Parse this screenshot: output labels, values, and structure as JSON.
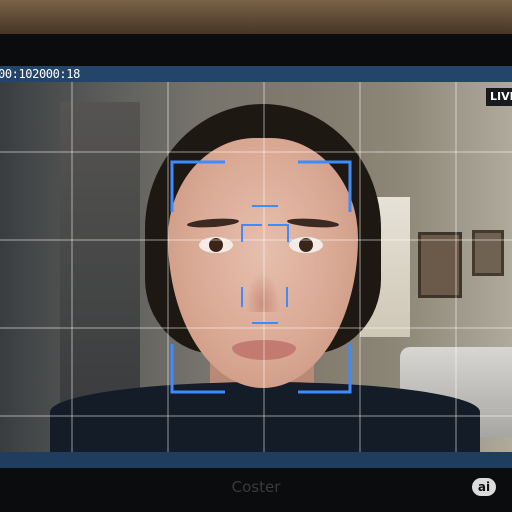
{
  "monitor": {
    "timecode": "00:102000:18",
    "live_label": "LIVE",
    "brand": "Coster",
    "badge": "ai"
  },
  "overlay": {
    "grid": "on",
    "grid_color": "#ffffff",
    "bracket_color": "#3d8bff",
    "top_bar_color": "#23456a",
    "bottom_bar_color": "#1f3d5c"
  }
}
